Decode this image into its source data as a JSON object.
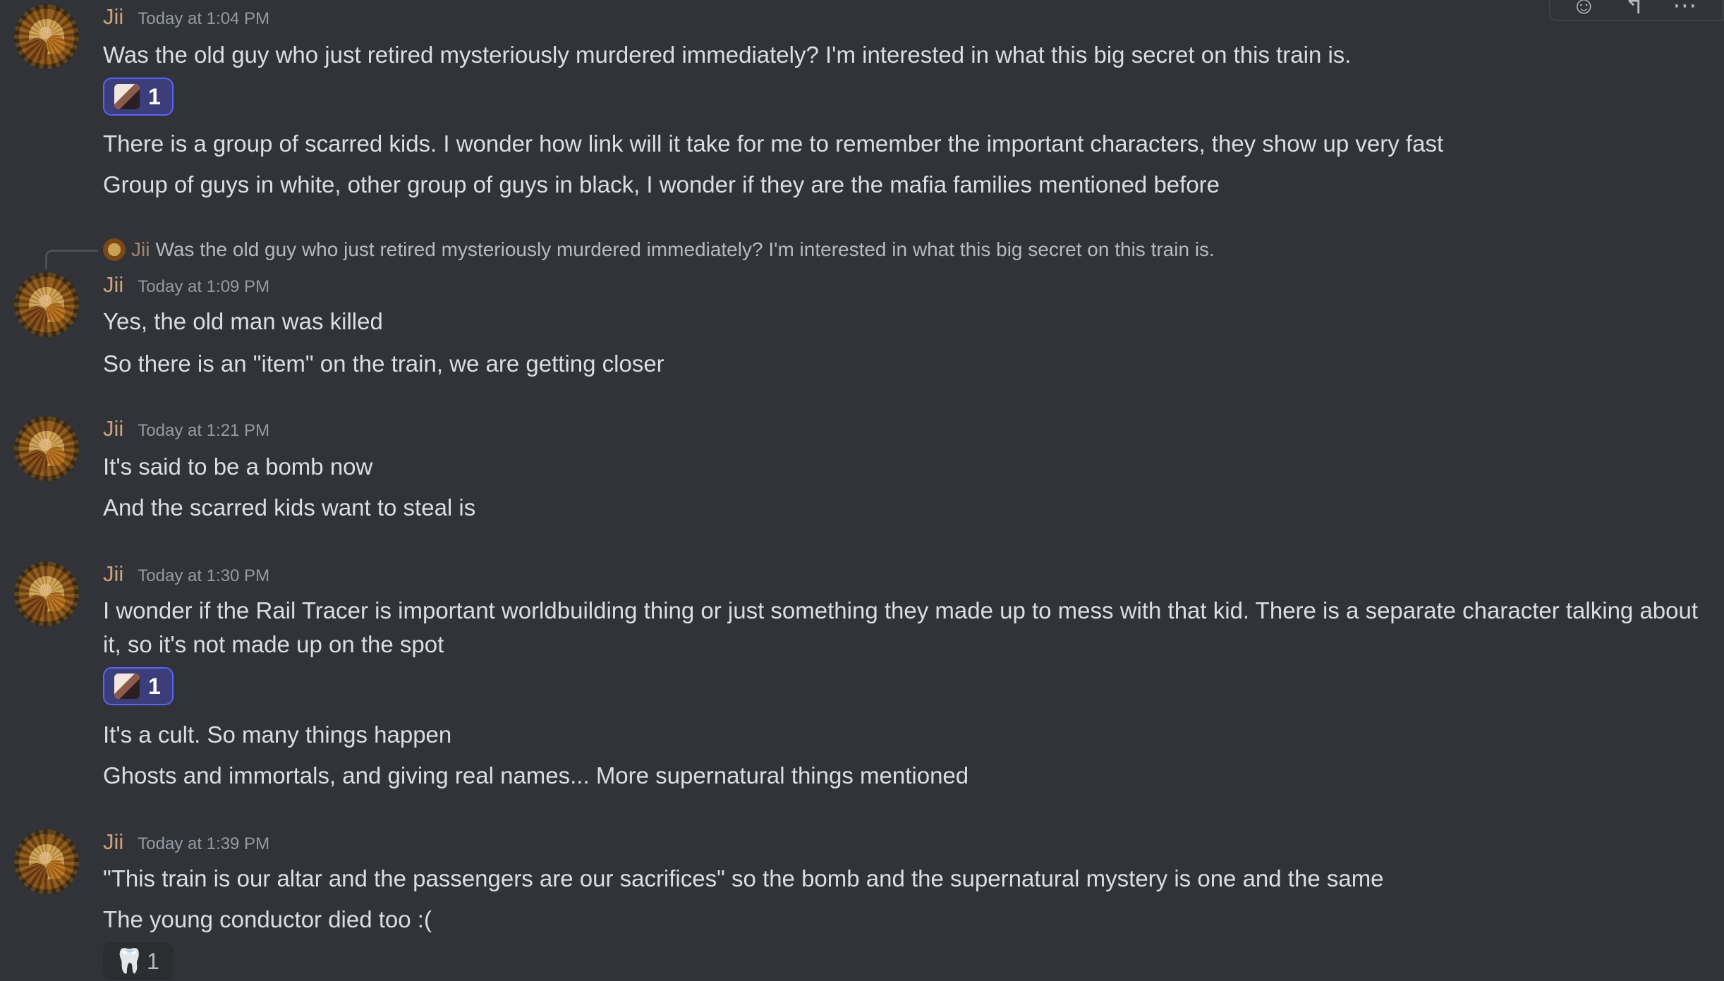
{
  "toolbar": {
    "icons": [
      "add-reaction-icon",
      "reply-icon",
      "more-icon"
    ]
  },
  "messages": [
    {
      "username": "Jii",
      "timestamp": "Today at 1:04 PM",
      "lines": [
        "Was the old guy who just retired mysteriously murdered immediately? I'm interested in what this big secret on this train is."
      ],
      "reaction": {
        "emoji": "custom-emoji",
        "count": "1"
      },
      "more_lines": [
        "There is a group of scarred kids. I wonder how link will it take for me to remember the important characters, they show up very fast",
        "Group of guys in white, other group of guys in black, I wonder if they are the mafia families mentioned before"
      ]
    },
    {
      "reply": {
        "username": "Jii",
        "text": "Was the old guy who just retired mysteriously murdered immediately? I'm interested in what this big secret on this train is."
      },
      "username": "Jii",
      "timestamp": "Today at 1:09 PM",
      "lines": [
        "Yes, the old man was killed",
        "So there is an \"item\" on the train, we are getting closer"
      ]
    },
    {
      "username": "Jii",
      "timestamp": "Today at 1:21 PM",
      "lines": [
        "It's said to be a bomb now",
        "And the scarred kids want to steal is"
      ]
    },
    {
      "username": "Jii",
      "timestamp": "Today at 1:30 PM",
      "lines": [
        "I wonder if the Rail Tracer is important worldbuilding thing or just something they made up to mess with that kid. There is a separate character talking about it, so it's not made up on the spot"
      ],
      "reaction": {
        "emoji": "custom-emoji",
        "count": "1"
      },
      "more_lines": [
        "It's a cult. So many things happen",
        "Ghosts and immortals, and giving real names... More supernatural things mentioned"
      ]
    },
    {
      "username": "Jii",
      "timestamp": "Today at 1:39 PM",
      "lines": [
        "\"This train is our altar and the passengers are our sacrifices\" so the bomb and the supernatural mystery is one and the same",
        "The young conductor died too :("
      ],
      "reaction": {
        "emoji": "tooth",
        "count": "1"
      }
    }
  ]
}
